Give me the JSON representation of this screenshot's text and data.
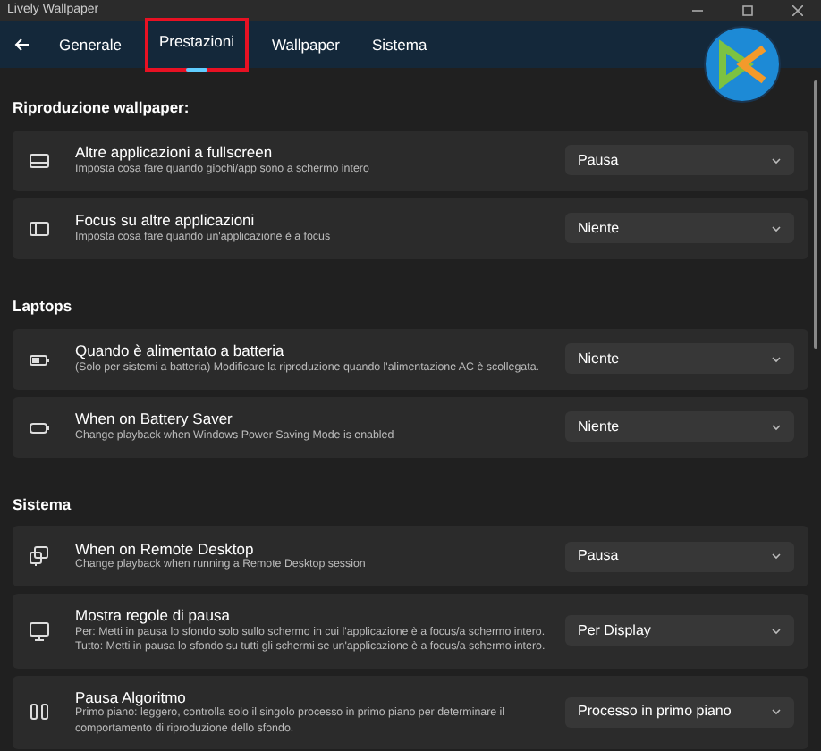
{
  "window": {
    "title": "Lively Wallpaper"
  },
  "tabs": [
    {
      "label": "Generale",
      "selected": false
    },
    {
      "label": "Prestazioni",
      "selected": true
    },
    {
      "label": "Wallpaper",
      "selected": false
    },
    {
      "label": "Sistema",
      "selected": false
    }
  ],
  "sections": [
    {
      "heading": "Riproduzione wallpaper:",
      "rows": [
        {
          "title": "Altre applicazioni a fullscreen",
          "description": "Imposta cosa fare quando giochi/app sono a schermo intero",
          "value": "Pausa"
        },
        {
          "title": "Focus su altre applicazioni",
          "description": "Imposta cosa fare quando un'applicazione è a focus",
          "value": "Niente"
        }
      ]
    },
    {
      "heading": "Laptops",
      "rows": [
        {
          "title": "Quando è alimentato a batteria",
          "description": "(Solo per sistemi a batteria) Modificare la riproduzione quando l'alimentazione AC è scollegata.",
          "value": "Niente"
        },
        {
          "title": "When on Battery Saver",
          "description": "Change playback when Windows Power Saving Mode is enabled",
          "value": "Niente"
        }
      ]
    },
    {
      "heading": "Sistema",
      "rows": [
        {
          "title": "When on Remote Desktop",
          "description": "Change playback when running a Remote Desktop session",
          "value": "Pausa"
        },
        {
          "title": "Mostra regole di pausa",
          "description": "Per: Metti in pausa lo sfondo solo sullo schermo in cui l'applicazione è a focus/a schermo intero. Tutto: Metti in pausa lo sfondo su tutti gli schermi se un'applicazione è a focus/a schermo intero.",
          "value": "Per Display"
        },
        {
          "title": "Pausa Algoritmo",
          "description": "Primo piano: leggero, controlla solo il singolo processo in primo piano per determinare il comportamento di riproduzione dello sfondo.",
          "value": "Processo in primo piano"
        }
      ]
    }
  ]
}
